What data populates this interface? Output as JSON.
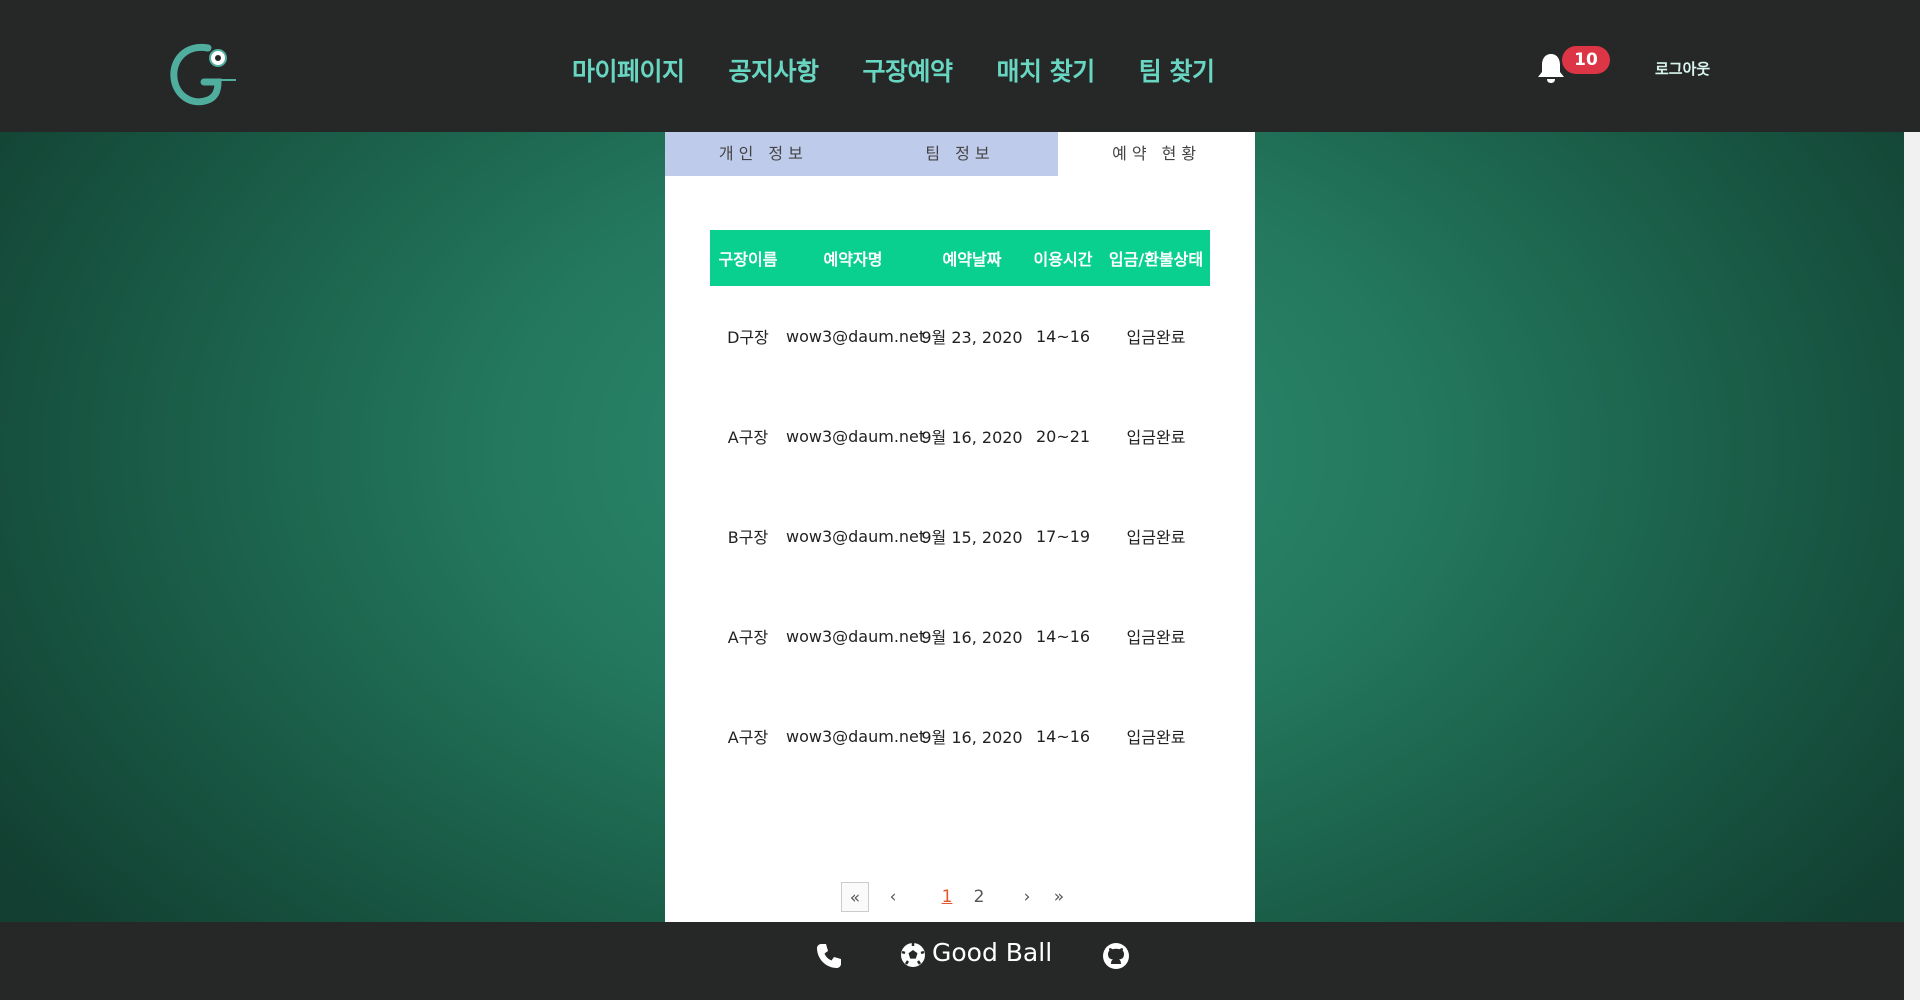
{
  "header": {
    "nav": [
      "마이페이지",
      "공지사항",
      "구장예약",
      "매치 찾기",
      "팀 찾기"
    ],
    "notification_count": "10",
    "logout": "로그아웃"
  },
  "tabs": [
    "개인 정보",
    "팀 정보",
    "예약 현황"
  ],
  "active_tab": "예약 현황",
  "table": {
    "columns": [
      "구장이름",
      "예약자명",
      "예약날짜",
      "이용시간",
      "입금/환불상태"
    ],
    "rows": [
      [
        "D구장",
        "wow3@daum.net",
        "9월 23, 2020",
        "14~16",
        "입금완료"
      ],
      [
        "A구장",
        "wow3@daum.net",
        "9월 16, 2020",
        "20~21",
        "입금완료"
      ],
      [
        "B구장",
        "wow3@daum.net",
        "9월 15, 2020",
        "17~19",
        "입금완료"
      ],
      [
        "A구장",
        "wow3@daum.net",
        "9월 16, 2020",
        "14~16",
        "입금완료"
      ],
      [
        "A구장",
        "wow3@daum.net",
        "9월 16, 2020",
        "14~16",
        "입금완료"
      ]
    ]
  },
  "pagination": {
    "first": "«",
    "prev": "‹",
    "pages": [
      "1",
      "2"
    ],
    "current": "1",
    "next": "›",
    "last": "»"
  },
  "footer": {
    "brand": "Good Ball"
  },
  "colors": {
    "accent": "#0ad08f",
    "nav_text": "#68d6c1",
    "badge": "#dc3545"
  },
  "icons": [
    "logo",
    "bell-icon",
    "phone-icon",
    "soccer-ball-icon",
    "github-icon"
  ]
}
